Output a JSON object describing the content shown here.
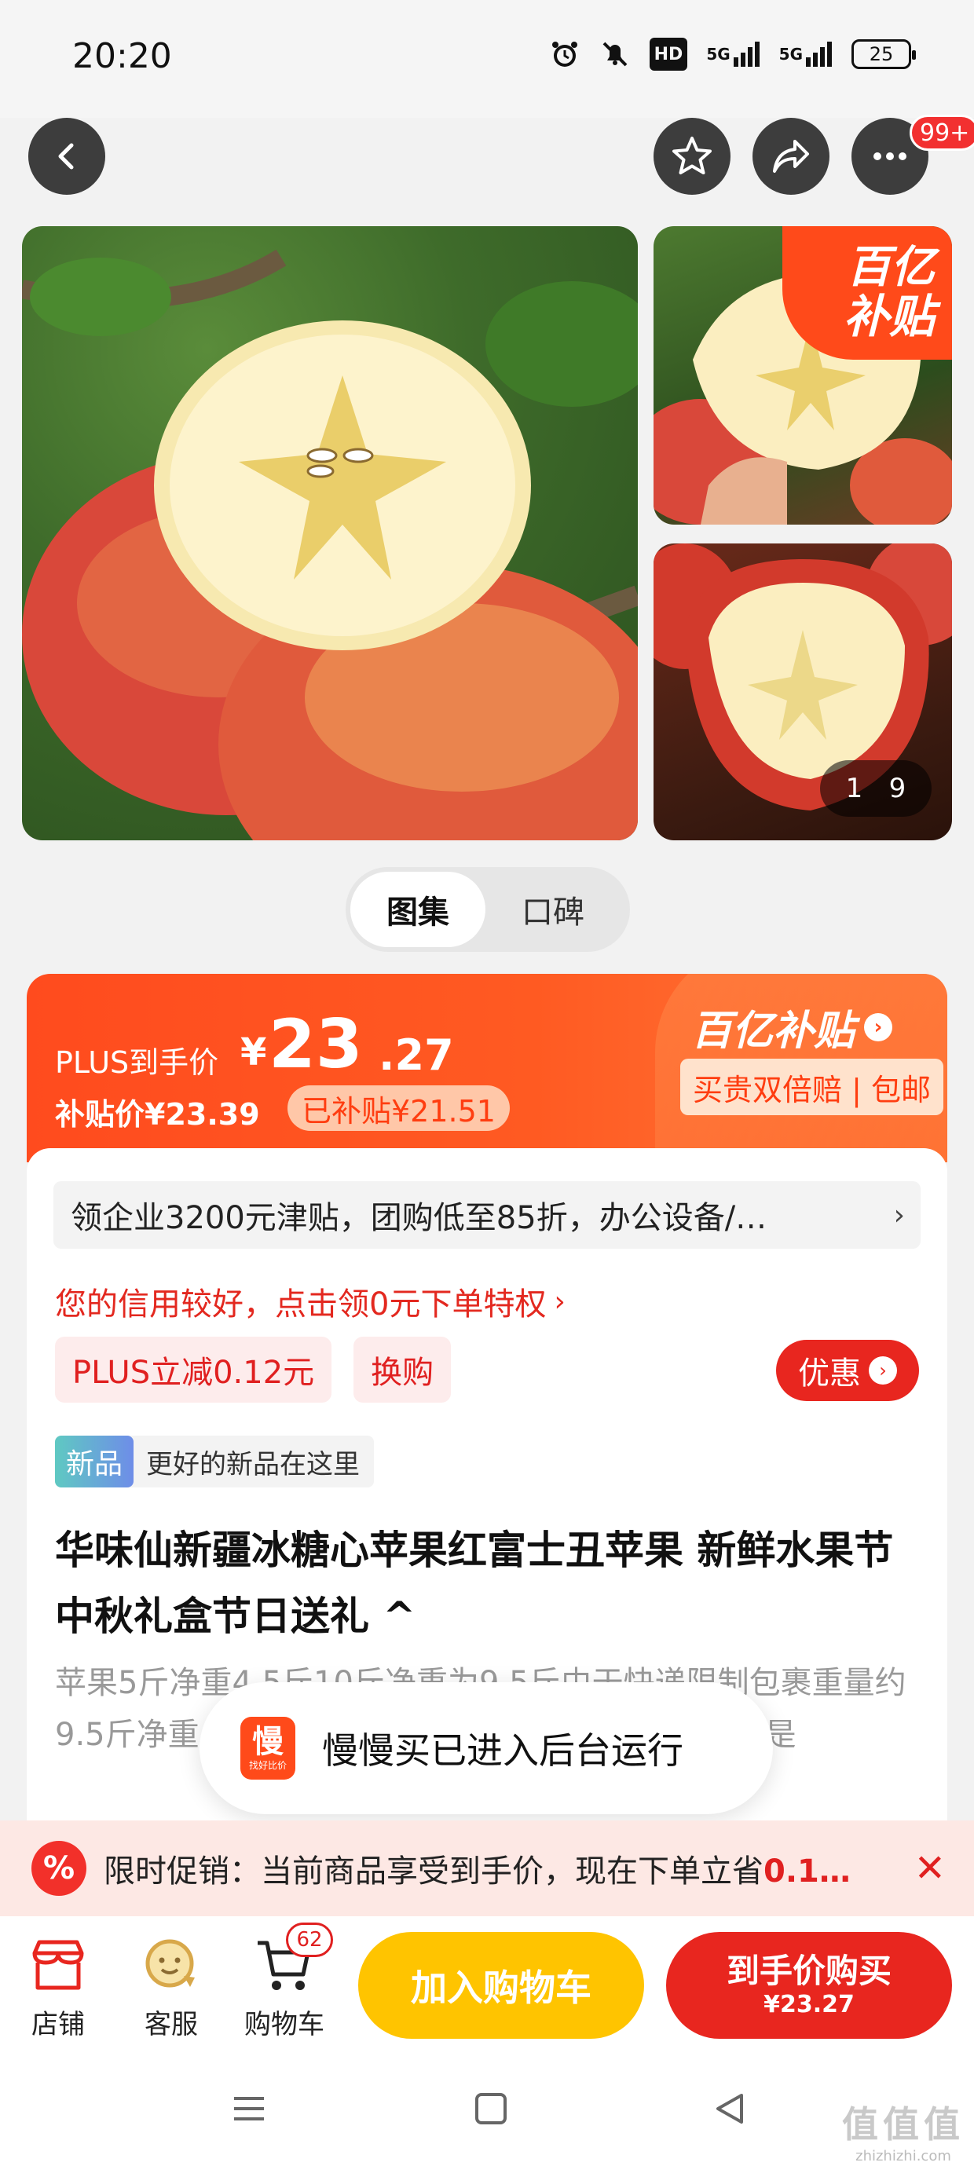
{
  "status_bar": {
    "time": "20:20",
    "network_1": "5G",
    "network_2": "5G",
    "hd_label": "HD",
    "battery": "25"
  },
  "top_nav": {
    "back_icon": "chevron-left-icon",
    "favorite_icon": "star-icon",
    "share_icon": "share-icon",
    "more_icon": "more-dots-icon",
    "more_badge": "99+"
  },
  "gallery": {
    "subsidy_tag_line1": "百亿",
    "subsidy_tag_line2": "补贴",
    "page_current": "1",
    "page_total": "9"
  },
  "segment": {
    "tabs": [
      {
        "label": "图集",
        "active": true
      },
      {
        "label": "口碑",
        "active": false
      }
    ]
  },
  "price": {
    "plus_label": "PLUS到手价",
    "currency": "¥",
    "integer": "23",
    "decimal": ".27",
    "subsidy_price": "补贴价¥23.39",
    "subsidized": "已补贴¥21.51",
    "brand": "百亿补贴",
    "brand_sub": "买贵双倍赔 | 包邮"
  },
  "content": {
    "coupon_text": "领企业3200元津贴，团购低至85折，办公设备/…",
    "credit_text": "您的信用较好，点击领0元下单特权",
    "plus_discount": "PLUS立减0.12元",
    "exchange": "换购",
    "offer_button": "优惠",
    "new_tag": "新品",
    "new_text": "更好的新品在这里",
    "title": "华味仙新疆冰糖心苹果红富士丑苹果 新鲜水果节中秋礼盒节日送礼 ^",
    "desc": "苹果5斤净重4.5斤10斤净重为9.5斤由于快递限制包裹重量约9.5斤净重，虽然很多地方的苹果都已经没有了，但是"
  },
  "toast": {
    "logo_char": "慢",
    "logo_sub": "找好比价",
    "text": "慢慢买已进入后台运行"
  },
  "promo": {
    "icon_char": "%",
    "text_prefix": "限时促销：当前商品享受到手价，现在下单立省",
    "text_highlight": "0.1…"
  },
  "action_bar": {
    "shop_label": "店铺",
    "service_label": "客服",
    "cart_label": "购物车",
    "cart_count": "62",
    "add_to_cart": "加入购物车",
    "buy_line1": "到手价购买",
    "buy_line2": "¥23.27"
  },
  "watermark": {
    "line1": "值值值",
    "line2": "zhizhizhi.com"
  },
  "colors": {
    "accent_red": "#e8261f",
    "subsidy_orange": "#ff4b1e",
    "cart_yellow": "#ffc400"
  }
}
